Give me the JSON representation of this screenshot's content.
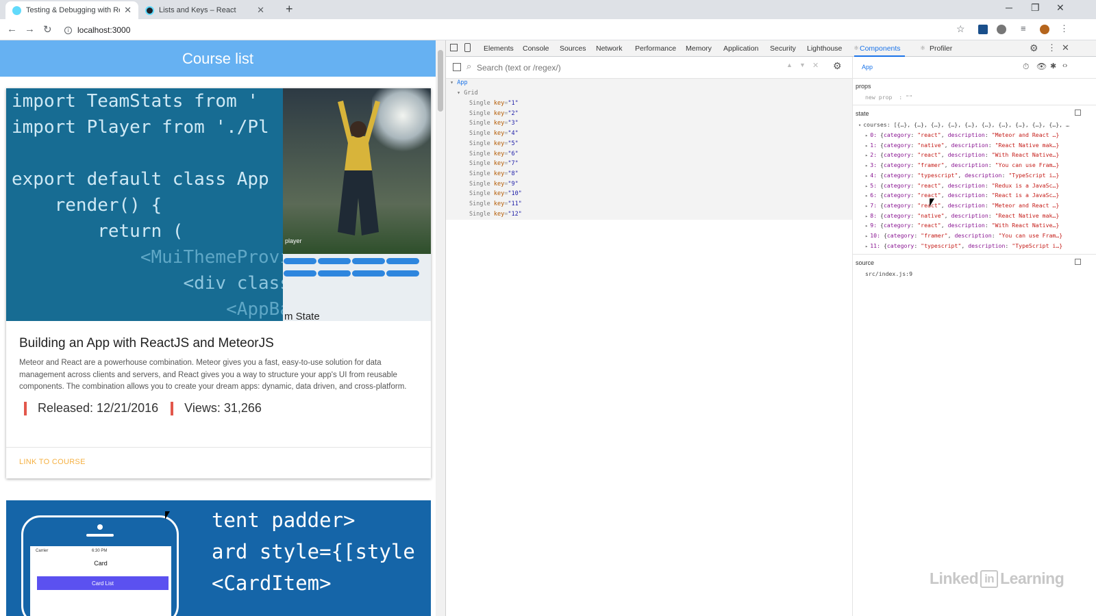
{
  "browser": {
    "tabs": [
      {
        "title": "Testing & Debugging with React",
        "active": true
      },
      {
        "title": "Lists and Keys – React",
        "active": false
      }
    ],
    "url": "localhost:3000"
  },
  "page": {
    "appbar_title": "Course list",
    "card1": {
      "code_lines": [
        "import TeamStats from '",
        "import Player from './Pl",
        "",
        "export default class App",
        "    render() {",
        "        return (",
        "            <MuiThemeProvide",
        "                <div classNa",
        "                    <AppBar"
      ],
      "photo_caption": "player",
      "partial_text": "m State",
      "title": "Building an App with ReactJS and MeteorJS",
      "description": "Meteor and React are a powerhouse combination. Meteor gives you a fast, easy-to-use solution for data management across clients and servers, and React gives you a way to structure your app's UI from reusable components. The combination allows you to create your dream apps: dynamic, data driven, and cross-platform.",
      "released": "Released: 12/21/2016",
      "views": "Views: 31,266",
      "link": "LINK TO COURSE"
    },
    "card2": {
      "code_lines": [
        "tent padder>",
        "ard style={[style",
        "<CardItem>"
      ],
      "phone": {
        "carrier": "Carrier",
        "time": "6:30 PM",
        "title": "Card",
        "button": "Card List"
      }
    }
  },
  "devtools": {
    "tabs": [
      "Elements",
      "Console",
      "Sources",
      "Network",
      "Performance",
      "Memory",
      "Application",
      "Security",
      "Lighthouse",
      "Components",
      "Profiler"
    ],
    "selected_tab": "Components",
    "search_placeholder": "Search (text or /regex/)",
    "tree": {
      "root": "App",
      "grid": "Grid",
      "items": [
        {
          "name": "Single",
          "key": "\"1\""
        },
        {
          "name": "Single",
          "key": "\"2\""
        },
        {
          "name": "Single",
          "key": "\"3\""
        },
        {
          "name": "Single",
          "key": "\"4\""
        },
        {
          "name": "Single",
          "key": "\"5\""
        },
        {
          "name": "Single",
          "key": "\"6\""
        },
        {
          "name": "Single",
          "key": "\"7\""
        },
        {
          "name": "Single",
          "key": "\"8\""
        },
        {
          "name": "Single",
          "key": "\"9\""
        },
        {
          "name": "Single",
          "key": "\"10\""
        },
        {
          "name": "Single",
          "key": "\"11\""
        },
        {
          "name": "Single",
          "key": "\"12\""
        }
      ]
    },
    "inspector": {
      "component": "App",
      "props_label": "props",
      "new_prop": "new prop",
      "new_prop_value": ": \"\"",
      "state_label": "state",
      "courses_summary": "courses: [{…}, {…}, {…}, {…}, {…}, {…}, {…}, {…}, {…}, {…}, …",
      "courses": [
        {
          "idx": "0:",
          "category": "\"react\"",
          "description": "\"Meteor and React …}"
        },
        {
          "idx": "1:",
          "category": "\"native\"",
          "description": "\"React Native mak…}"
        },
        {
          "idx": "2:",
          "category": "\"react\"",
          "description": "\"With React Native…}"
        },
        {
          "idx": "3:",
          "category": "\"framer\"",
          "description": "\"You can use Fram…}"
        },
        {
          "idx": "4:",
          "category": "\"typescript\"",
          "description": "\"TypeScript i…}"
        },
        {
          "idx": "5:",
          "category": "\"react\"",
          "description": "\"Redux is a JavaSc…}"
        },
        {
          "idx": "6:",
          "category": "\"react\"",
          "description": "\"React is a JavaSc…}"
        },
        {
          "idx": "7:",
          "category": "\"react\"",
          "description": "\"Meteor and React …}"
        },
        {
          "idx": "8:",
          "category": "\"native\"",
          "description": "\"React Native mak…}"
        },
        {
          "idx": "9:",
          "category": "\"react\"",
          "description": "\"With React Native…}"
        },
        {
          "idx": "10:",
          "category": "\"framer\"",
          "description": "\"You can use Fram…}"
        },
        {
          "idx": "11:",
          "category": "\"typescript\"",
          "description": "\"TypeScript i…}"
        }
      ],
      "source_label": "source",
      "source_value": "src/index.js:9"
    }
  },
  "watermark": {
    "left": "Linked",
    "box": "in",
    "right": "Learning"
  },
  "colors": {
    "appbar": "#66b1f2",
    "code_bg": "#176c93",
    "accent_link": "#f5b041",
    "release_bar": "#e2574c",
    "devtools_selected": "#1a73e8"
  }
}
